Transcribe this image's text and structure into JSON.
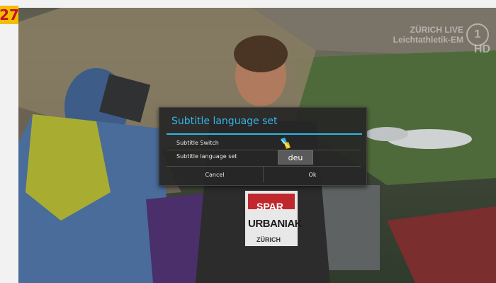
{
  "badge": {
    "number": "27"
  },
  "broadcast": {
    "line1": "ZÜRICH LIVE",
    "line2": "Leichtathletik-EM",
    "channel": "1",
    "hd": "HD"
  },
  "bib": {
    "sponsor": "SPAR",
    "name": "URBANIAK",
    "city": "ZÜRICH"
  },
  "dialog": {
    "title": "Subtitle language set",
    "rows": [
      {
        "label": "Subtitle Switch",
        "control": "toggle-icon"
      },
      {
        "label": "Subtitle language set",
        "value": "deu"
      }
    ],
    "cancel_label": "Cancel",
    "ok_label": "Ok"
  },
  "colors": {
    "accent": "#33b5e5",
    "badge_bg": "#f0c000",
    "badge_text": "#c8102e"
  }
}
